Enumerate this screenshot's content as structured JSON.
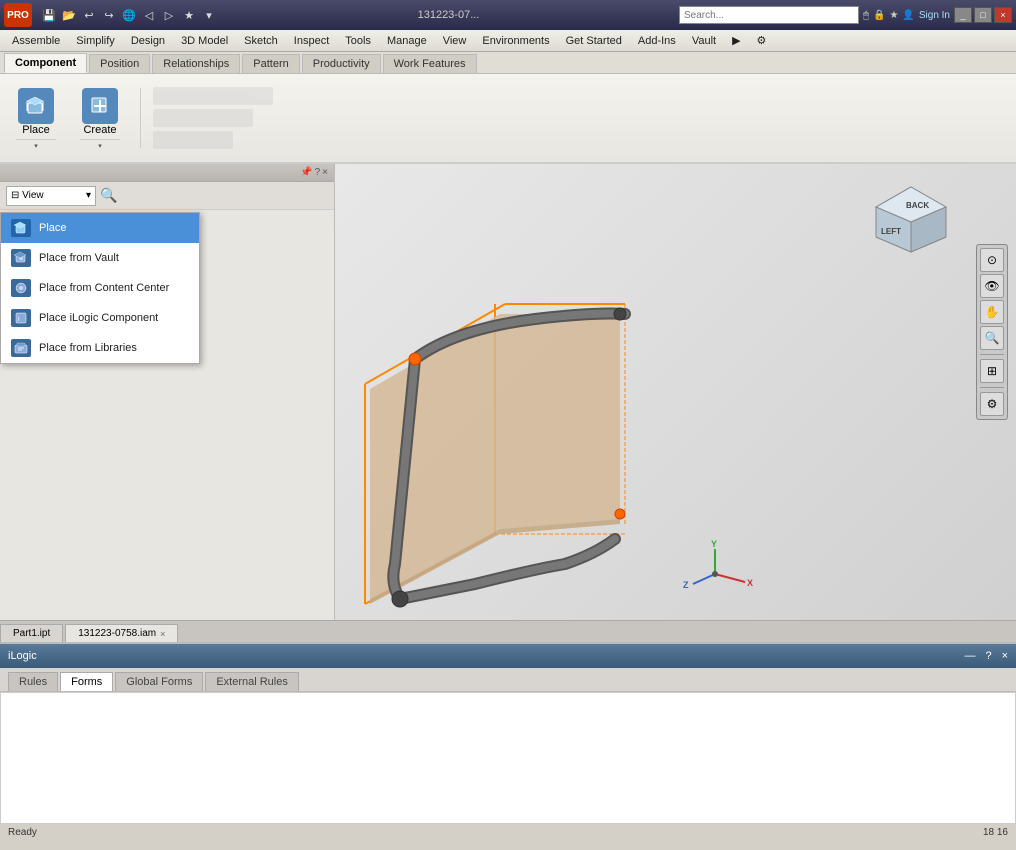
{
  "titlebar": {
    "app_name": "PRO",
    "title": "131223-07...",
    "sign_in": "Sign In",
    "help_symbol": "?",
    "quick_access": [
      "←",
      "→",
      "⊞",
      "⯇",
      "⯈",
      "★",
      "⊕"
    ]
  },
  "menu": {
    "items": [
      "Assemble",
      "Simplify",
      "Design",
      "3D Model",
      "Sketch",
      "Inspect",
      "Tools",
      "Manage",
      "View",
      "Environments",
      "Get Started",
      "Add-Ins",
      "Vault",
      "▶",
      "⚙"
    ]
  },
  "ribbon_tabs": {
    "tabs": [
      "Component",
      "Position",
      "Relationships",
      "Pattern",
      "Productivity",
      "Work Features"
    ],
    "active": "Component"
  },
  "toolbar": {
    "place_label": "Place",
    "create_label": "Create",
    "place_icon": "📦",
    "create_icon": "✏"
  },
  "dropdown": {
    "items": [
      {
        "label": "Place",
        "icon_color": "#4488cc",
        "highlighted": true
      },
      {
        "label": "Place from Vault",
        "icon_color": "#4488cc",
        "highlighted": false
      },
      {
        "label": "Place from Content Center",
        "icon_color": "#4488cc",
        "highlighted": false
      },
      {
        "label": "Place iLogic Component",
        "icon_color": "#4488cc",
        "highlighted": false
      },
      {
        "label": "Place from Libraries",
        "icon_color": "#4488cc",
        "highlighted": false
      }
    ]
  },
  "viewcube": {
    "back_label": "BACK",
    "left_label": "LEFT"
  },
  "bottom_panel": {
    "title": "iLogic",
    "close_symbol": "×",
    "help_symbol": "?",
    "tabs": [
      "Rules",
      "Forms",
      "Global Forms",
      "External Rules"
    ],
    "active_tab": "Forms"
  },
  "file_tabs": [
    {
      "label": "Part1.ipt",
      "active": false
    },
    {
      "label": "131223-0758.iam",
      "active": true,
      "has_close": true
    }
  ],
  "status_bar": {
    "ready": "Ready",
    "coords": "18    16"
  },
  "colors": {
    "highlight_blue": "#4a90d9",
    "toolbar_bg": "#f5f3ee",
    "ribbon_active": "#f5f3ee",
    "viewport_bg": "#d8d8d8"
  }
}
